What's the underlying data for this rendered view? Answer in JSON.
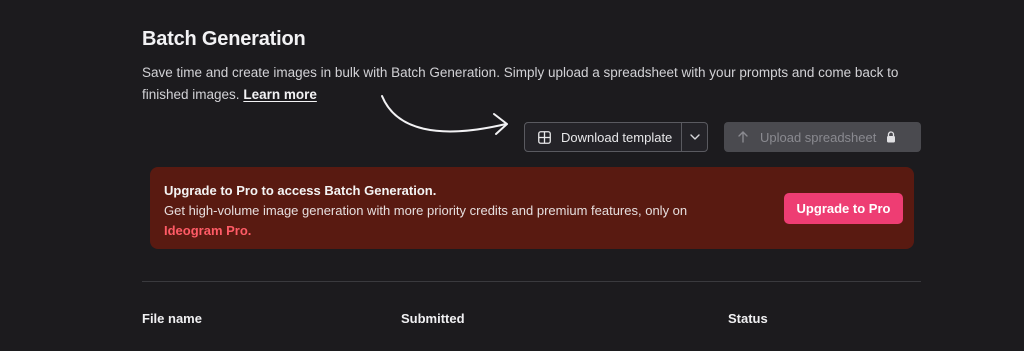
{
  "header": {
    "title": "Batch Generation",
    "description": "Save time and create images in bulk with Batch Generation. Simply upload a spreadsheet with your prompts and come back to finished images.",
    "learn_more": "Learn more"
  },
  "actions": {
    "download_template": "Download template",
    "upload_spreadsheet": "Upload spreadsheet"
  },
  "banner": {
    "title": "Upgrade to Pro to access Batch Generation.",
    "text": "Get high-volume image generation with more priority credits and premium features, only on",
    "link": "Ideogram Pro.",
    "button": "Upgrade to Pro"
  },
  "table": {
    "columns": [
      "File name",
      "Submitted",
      "Status"
    ]
  },
  "colors": {
    "background": "#1c1b1e",
    "banner": "#591a11",
    "accent": "#ee3d73",
    "link": "#ff5b66"
  },
  "icons": {
    "download": "grid-icon",
    "caret": "chevron-down-icon",
    "upload": "arrow-up-icon",
    "lock": "lock-icon",
    "pointer": "curved-arrow-icon"
  }
}
